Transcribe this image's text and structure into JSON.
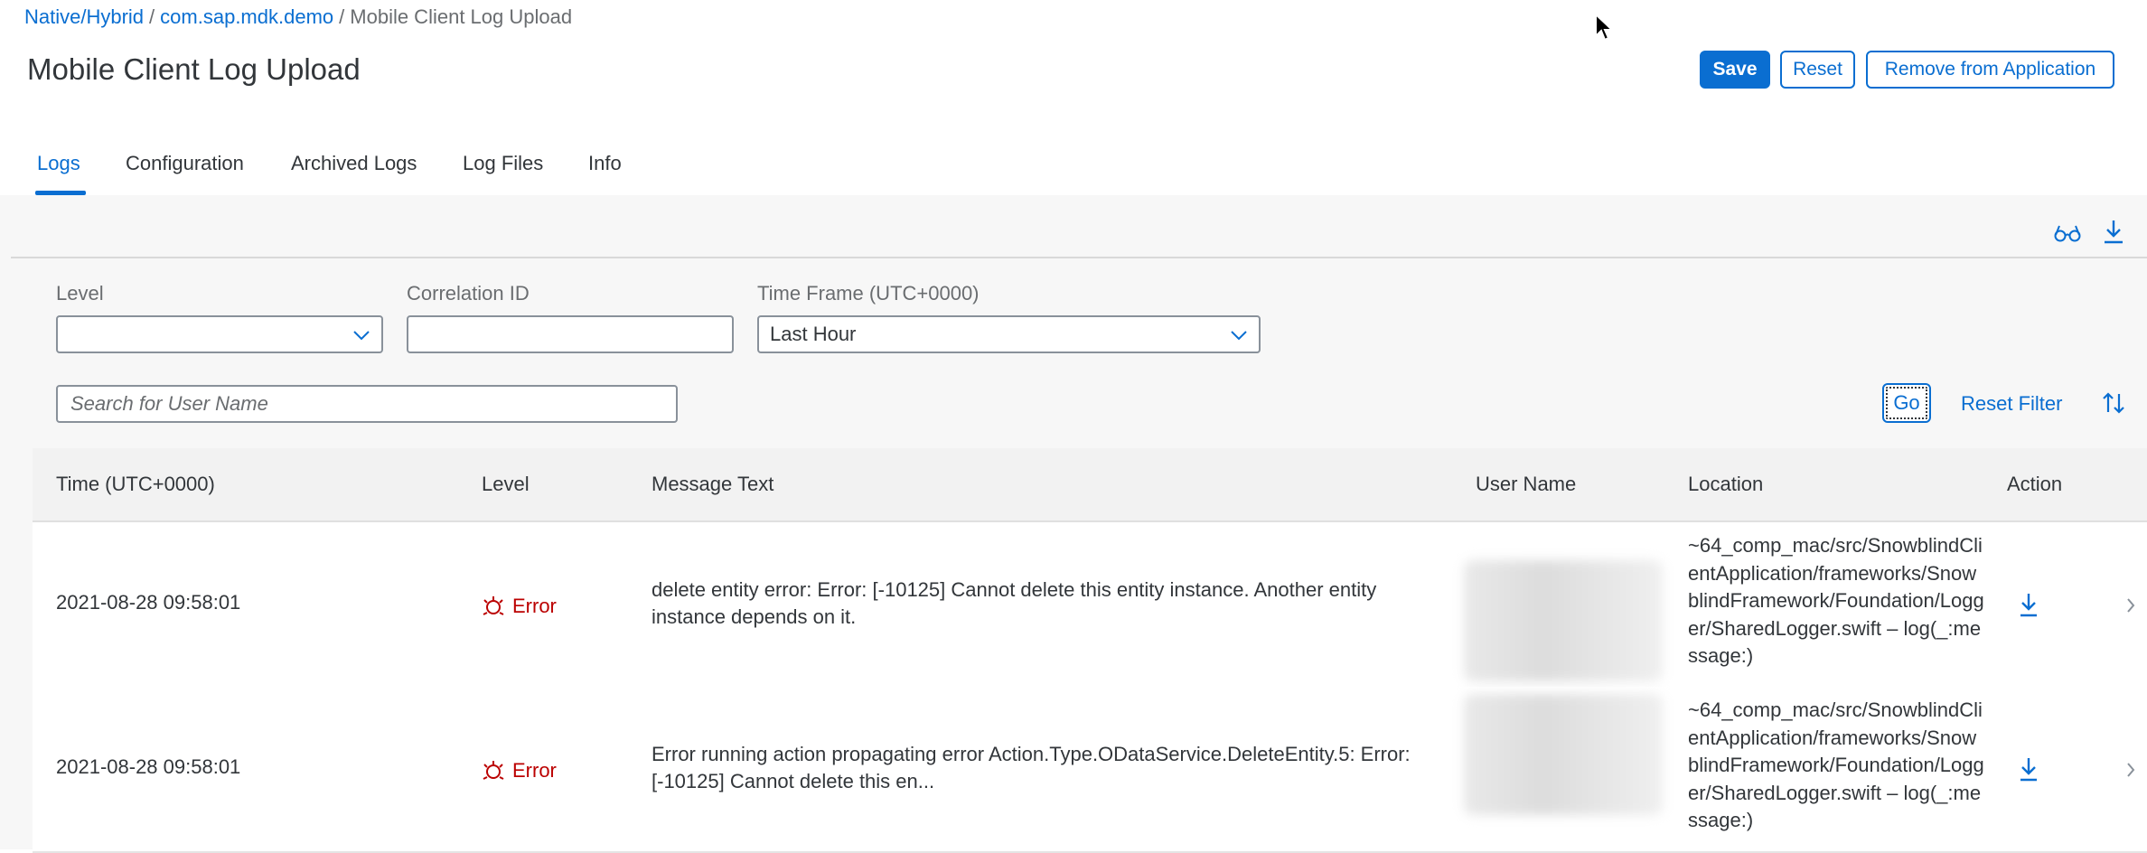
{
  "breadcrumb": {
    "items": [
      "Native/Hybrid",
      "com.sap.mdk.demo"
    ],
    "current": "Mobile Client Log Upload",
    "separator": "/"
  },
  "header": {
    "title": "Mobile Client Log Upload",
    "save_label": "Save",
    "reset_label": "Reset",
    "remove_label": "Remove from Application"
  },
  "tabs": [
    {
      "label": "Logs",
      "active": true
    },
    {
      "label": "Configuration",
      "active": false
    },
    {
      "label": "Archived Logs",
      "active": false
    },
    {
      "label": "Log Files",
      "active": false
    },
    {
      "label": "Info",
      "active": false
    }
  ],
  "toolbar": {
    "view_icon": "glasses-icon",
    "download_icon": "download-icon"
  },
  "filters": {
    "level": {
      "label": "Level",
      "value": ""
    },
    "correlation": {
      "label": "Correlation ID",
      "value": ""
    },
    "timeframe": {
      "label": "Time Frame (UTC+0000)",
      "value": "Last Hour"
    },
    "search": {
      "placeholder": "Search for User Name",
      "value": ""
    },
    "go_label": "Go",
    "reset_filter_label": "Reset Filter",
    "sort_icon": "sort-icon"
  },
  "table": {
    "columns": [
      "Time (UTC+0000)",
      "Level",
      "Message Text",
      "User Name",
      "Location",
      "Action"
    ],
    "rows": [
      {
        "time": "2021-08-28 09:58:01",
        "level": "Error",
        "message": "delete entity error: Error: [-10125] Cannot delete this entity instance. Another entity instance depends on it.",
        "user": "",
        "location": "~64_comp_mac/src/SnowblindClientApplication/frameworks/SnowblindFramework/Foundation/Logger/SharedLogger.swift – log(_:message:)"
      },
      {
        "time": "2021-08-28 09:58:01",
        "level": "Error",
        "message": "Error running action propagating error Action.Type.ODataService.DeleteEntity.5: Error: [-10125] Cannot delete this en...",
        "user": "",
        "location": "~64_comp_mac/src/SnowblindClientApplication/frameworks/SnowblindFramework/Foundation/Logger/SharedLogger.swift – log(_:message:)"
      }
    ]
  },
  "colors": {
    "accent": "#0a6ed1",
    "error": "#bb0000",
    "text": "#32363a",
    "muted": "#6a6d70"
  }
}
